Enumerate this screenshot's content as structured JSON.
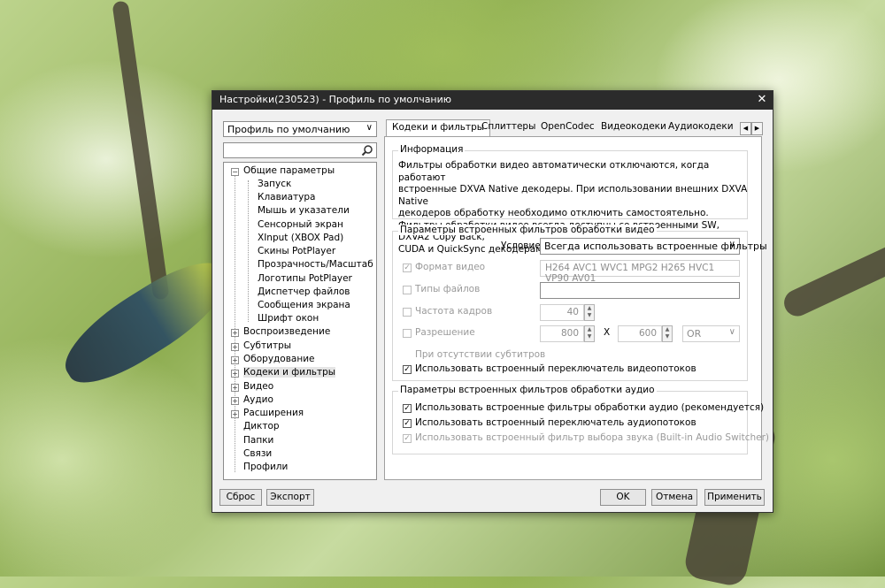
{
  "window": {
    "title": "Настройки(230523) - Профиль по умолчанию",
    "close": "✕"
  },
  "profile": {
    "value": "Профиль по умолчанию",
    "arrow": "∨"
  },
  "search": {
    "value": ""
  },
  "tree": {
    "root": "Общие параметры",
    "children": [
      "Запуск",
      "Клавиатура",
      "Мышь и указатели",
      "Сенсорный экран",
      "XInput (XBOX Pad)",
      "Скины PotPlayer",
      "Прозрачность/Масштаб",
      "Логотипы PotPlayer",
      "Диспетчер файлов",
      "Сообщения экрана",
      "Шрифт окон"
    ],
    "sections": [
      "Воспроизведение",
      "Субтитры",
      "Оборудование",
      "Кодеки и фильтры",
      "Видео",
      "Аудио",
      "Расширения",
      "Диктор",
      "Папки",
      "Связи",
      "Профили"
    ]
  },
  "tabs": [
    "Кодеки и фильтры",
    "Сплиттеры",
    "OpenCodec",
    "Видеокодеки",
    "Аудиокодеки"
  ],
  "info": {
    "title": "Информация",
    "lines": [
      "Фильтры обработки видео автоматически отключаются, когда работают",
      "встроенные DXVA Native декодеры. При использовании внешних DXVA Native",
      "декодеров обработку необходимо отключить самостоятельно.",
      "Фильтры обработки видео всегда доступны со встроенными SW, DXVA2 Copy Back,",
      "CUDA и QuickSync декодерами."
    ]
  },
  "video": {
    "title": "Параметры встроенных фильтров обработки видео",
    "condition_label": "Условие:",
    "condition_value": "Всегда использовать встроенные фильтры",
    "format_label": "Формат видео",
    "format_value": "H264 AVC1 WVC1 MPG2 H265 HVC1 VP90 AV01",
    "filetypes_label": "Типы файлов",
    "filetypes_value": "",
    "framerate_label": "Частота кадров",
    "framerate_value": "40",
    "resolution_label": "Разрешение",
    "width_value": "800",
    "x_sep": "X",
    "height_value": "600",
    "logic_value": "OR",
    "nosubs_label": "При отсутствии субтитров",
    "switcher_label": "Использовать встроенный переключатель видеопотоков"
  },
  "audio": {
    "title": "Параметры встроенных фильтров обработки аудио",
    "filters_label": "Использовать встроенные фильтры обработки аудио (рекомендуется)",
    "switcher_label": "Использовать встроенный переключатель аудиопотоков",
    "selector_label": "Использовать встроенный фильтр выбора звука (Built-in Audio Switcher)"
  },
  "buttons": {
    "reset": "Сброс",
    "export": "Экспорт",
    "ok": "OK",
    "cancel": "Отмена",
    "apply": "Применить"
  },
  "marks": {
    "check": "✓",
    "minus": "−",
    "plus": "+",
    "up": "▲",
    "down": "▼",
    "left": "◀",
    "right": "▶"
  }
}
